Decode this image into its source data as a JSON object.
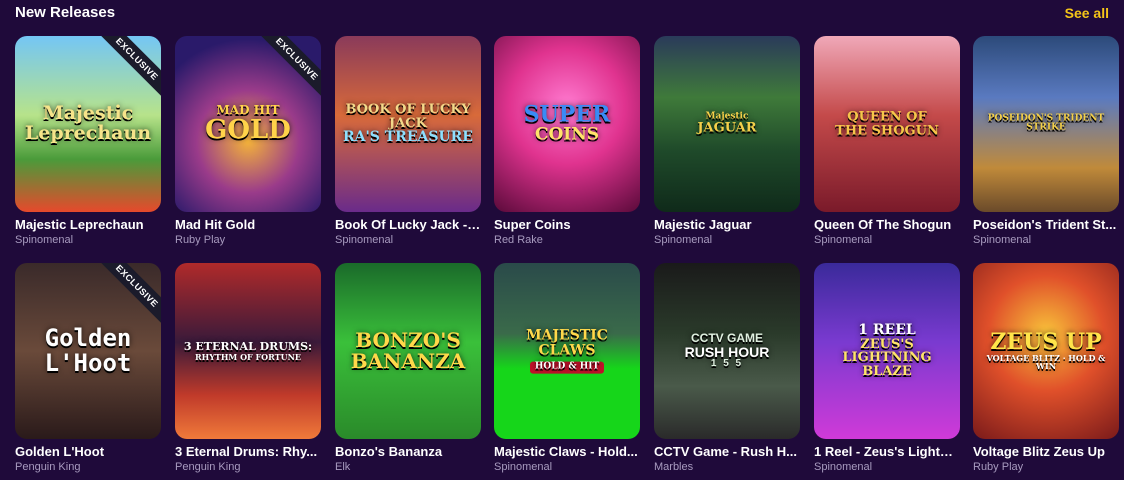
{
  "section": {
    "title": "New Releases",
    "see_all_label": "See all"
  },
  "badge_label": "EXCLUSIVE",
  "games_row1": [
    {
      "name": "Majestic Leprechaun",
      "provider": "Spinomenal",
      "art_line1": "Majestic",
      "art_line2": "Leprechaun",
      "exclusive": true
    },
    {
      "name": "Mad Hit Gold",
      "provider": "Ruby Play",
      "art_line1": "MAD HIT",
      "art_line2": "GOLD",
      "exclusive": true
    },
    {
      "name": "Book Of Lucky Jack - ...",
      "provider": "Spinomenal",
      "art_line1": "BOOK OF LUCKY JACK",
      "art_line2": "RA'S TREASURE",
      "exclusive": false
    },
    {
      "name": "Super Coins",
      "provider": "Red Rake",
      "art_line1": "SUPER",
      "art_line2": "COINS",
      "exclusive": false
    },
    {
      "name": "Majestic Jaguar",
      "provider": "Spinomenal",
      "art_line1": "Majestic",
      "art_line2": "JAGUAR",
      "exclusive": false
    },
    {
      "name": "Queen Of The Shogun",
      "provider": "Spinomenal",
      "art_line1": "QUEEN OF",
      "art_line2": "THE SHOGUN",
      "exclusive": false
    },
    {
      "name": "Poseidon's Trident St...",
      "provider": "Spinomenal",
      "art_line1": "POSEIDON'S TRIDENT STRIKE",
      "art_line2": "",
      "exclusive": false
    }
  ],
  "games_row2": [
    {
      "name": "Golden L'Hoot",
      "provider": "Penguin King",
      "art_line1": "Golden",
      "art_line2": "L'Hoot",
      "exclusive": true
    },
    {
      "name": "3 Eternal Drums: Rhy...",
      "provider": "Penguin King",
      "art_line1": "3 ETERNAL DRUMS:",
      "art_line2": "RHYTHM OF FORTUNE",
      "exclusive": false
    },
    {
      "name": "Bonzo's Bananza",
      "provider": "Elk",
      "art_line1": "BONZO'S",
      "art_line2": "BANANZA",
      "exclusive": false
    },
    {
      "name": "Majestic Claws - Hold...",
      "provider": "Spinomenal",
      "art_line1": "MAJESTIC CLAWS",
      "art_line2": "HOLD & HIT",
      "exclusive": false
    },
    {
      "name": "CCTV Game - Rush H...",
      "provider": "Marbles",
      "art_line1": "CCTV GAME",
      "art_line2": "RUSH HOUR",
      "art_line3": "1 5 5",
      "exclusive": false
    },
    {
      "name": "1 Reel - Zeus's Lightni...",
      "provider": "Spinomenal",
      "art_line1": "1 REEL",
      "art_line2": "ZEUS'S LIGHTNING BLAZE",
      "exclusive": false
    },
    {
      "name": "Voltage Blitz Zeus Up",
      "provider": "Ruby Play",
      "art_line1": "ZEUS UP",
      "art_line2": "VOLTAGE BLITZ · HOLD & WIN",
      "exclusive": false
    }
  ]
}
